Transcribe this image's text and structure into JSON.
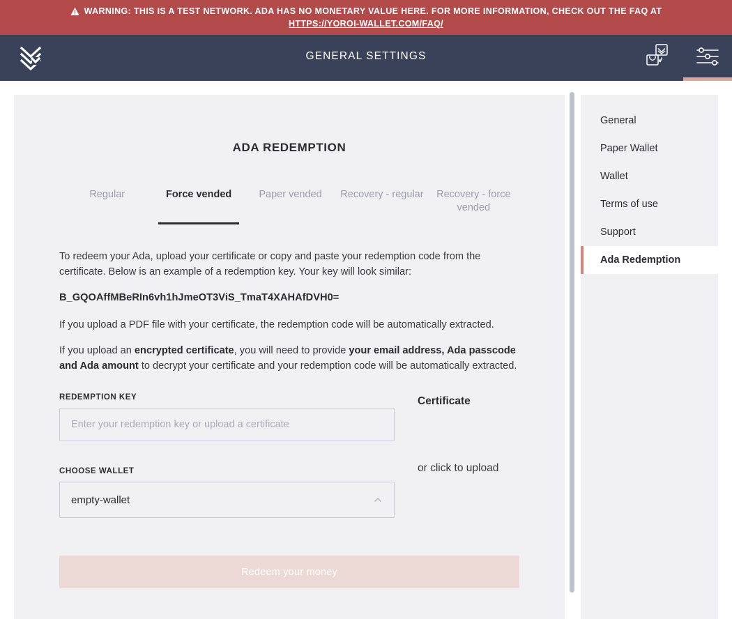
{
  "warning": {
    "icon": "warning-triangle-icon",
    "text": "WARNING: THIS IS A TEST NETWORK. ADA HAS NO MONETARY VALUE HERE. FOR MORE INFORMATION, CHECK OUT THE FAQ AT",
    "link": "HTTPS://YOROI-WALLET.COM/FAQ/",
    "background_color": "#b24a4a"
  },
  "topbar": {
    "logo_icon": "yoroi-logo-icon",
    "title": "GENERAL SETTINGS",
    "background_color": "#394258",
    "actions": [
      {
        "icon": "wallet-switch-icon",
        "label": "Switch wallet",
        "active": false
      },
      {
        "icon": "settings-sliders-icon",
        "label": "Settings",
        "active": true
      }
    ],
    "active_indicator_color": "#dba79d"
  },
  "main": {
    "page_title": "ADA REDEMPTION",
    "tabs": [
      {
        "label": "Regular",
        "active": false
      },
      {
        "label": "Force vended",
        "active": true
      },
      {
        "label": "Paper vended",
        "active": false
      },
      {
        "label": "Recovery - regular",
        "active": false
      },
      {
        "label": "Recovery - force vended",
        "active": false
      }
    ],
    "paragraphs": {
      "intro": "To redeem your Ada, upload your certificate or copy and paste your redemption code from the certificate. Below is an example of a redemption key. Your key will look similar:",
      "key_sample": "B_GQOAffMBeRIn6vh1hJmeOT3ViS_TmaT4XAHAfDVH0=",
      "pdf_note": "If you upload a PDF file with your certificate, the redemption code will be automatically extracted.",
      "encrypted_prefix": "If you upload an ",
      "encrypted_bold_1": "encrypted certificate",
      "encrypted_middle": ", you will need to provide ",
      "encrypted_bold_2": "your email address, Ada passcode and Ada amount",
      "encrypted_suffix": " to decrypt your certificate and your redemption code will be automatically extracted."
    },
    "form": {
      "redemption_key_label": "REDEMPTION KEY",
      "redemption_key_value": "",
      "redemption_key_placeholder": "Enter your redemption key or upload a certificate",
      "choose_wallet_label": "CHOOSE WALLET",
      "choose_wallet_value": "empty-wallet",
      "choose_wallet_chevron": "chevron-up-icon",
      "certificate_title": "Certificate",
      "certificate_hint": "or click to upload"
    },
    "submit_label": "Redeem your money",
    "submit_disabled_color": "#ecd9d6"
  },
  "sidebar": {
    "items": [
      {
        "label": "General",
        "active": false
      },
      {
        "label": "Paper Wallet",
        "active": false
      },
      {
        "label": "Wallet",
        "active": false
      },
      {
        "label": "Terms of use",
        "active": false
      },
      {
        "label": "Support",
        "active": false
      },
      {
        "label": "Ada Redemption",
        "active": true
      }
    ],
    "active_marker_color": "#d9837a"
  }
}
